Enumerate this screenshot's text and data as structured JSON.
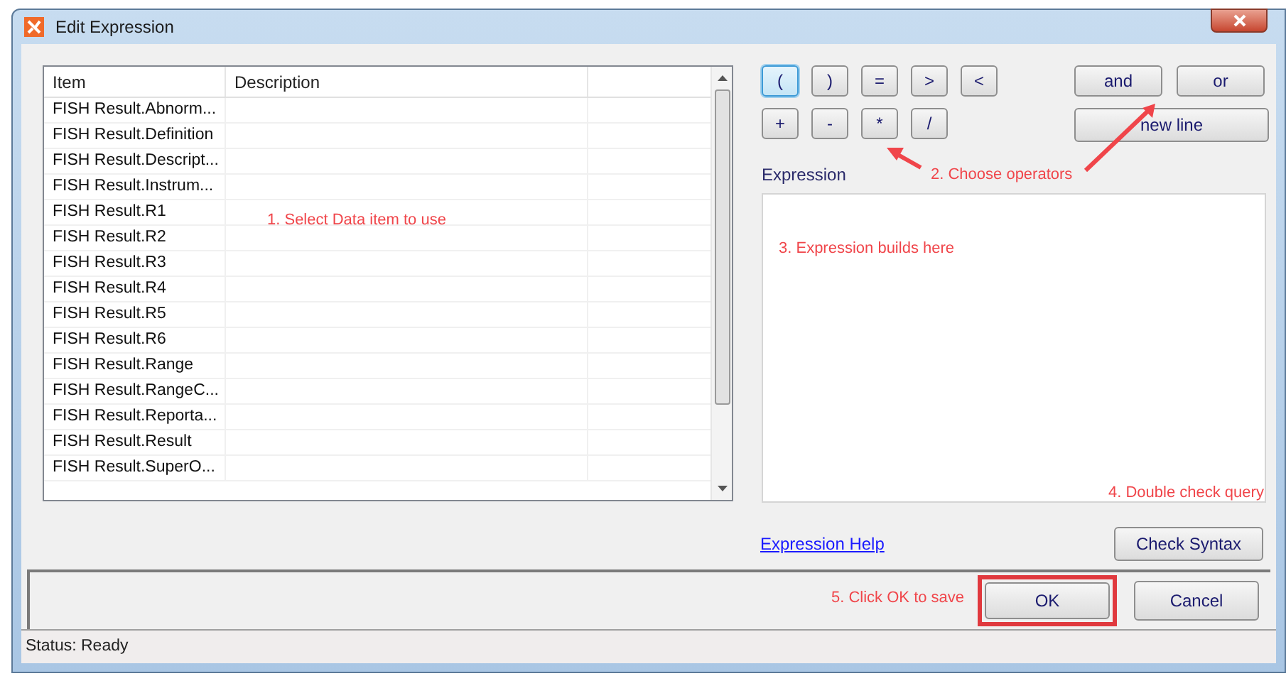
{
  "window": {
    "title": "Edit Expression"
  },
  "table": {
    "columns": [
      "Item",
      "Description"
    ],
    "rows": [
      {
        "item": "FISH Result.Abnorm..."
      },
      {
        "item": "FISH Result.Definition"
      },
      {
        "item": "FISH Result.Descript..."
      },
      {
        "item": "FISH Result.Instrum..."
      },
      {
        "item": "FISH Result.R1"
      },
      {
        "item": "FISH Result.R2"
      },
      {
        "item": "FISH Result.R3"
      },
      {
        "item": "FISH Result.R4"
      },
      {
        "item": "FISH Result.R5"
      },
      {
        "item": "FISH Result.R6"
      },
      {
        "item": "FISH Result.Range"
      },
      {
        "item": "FISH Result.RangeC..."
      },
      {
        "item": "FISH Result.Reporta..."
      },
      {
        "item": "FISH Result.Result"
      },
      {
        "item": "FISH Result.SuperO..."
      }
    ]
  },
  "operators": [
    [
      {
        "label": "(",
        "focused": true
      },
      {
        "label": ")",
        "focused": false
      },
      {
        "label": "=",
        "focused": false
      },
      {
        "label": ">",
        "focused": false
      },
      {
        "label": "<",
        "focused": false
      }
    ],
    [
      {
        "label": "+",
        "focused": false
      },
      {
        "label": "-",
        "focused": false
      },
      {
        "label": "*",
        "focused": false
      },
      {
        "label": "/",
        "focused": false
      }
    ]
  ],
  "logic_buttons": [
    "and",
    "or"
  ],
  "new_line_button": "new line",
  "expression": {
    "label": "Expression"
  },
  "help_link": "Expression Help",
  "check_syntax_button": "Check Syntax",
  "ok_button": {
    "label": "OK",
    "highlighted": true
  },
  "cancel_button": "Cancel",
  "status_bar": "Status: Ready",
  "annotations": [
    "1. Select Data item to use",
    "2. Choose operators",
    "3. Expression builds here",
    "4. Double check query",
    "5. Click OK to save"
  ]
}
